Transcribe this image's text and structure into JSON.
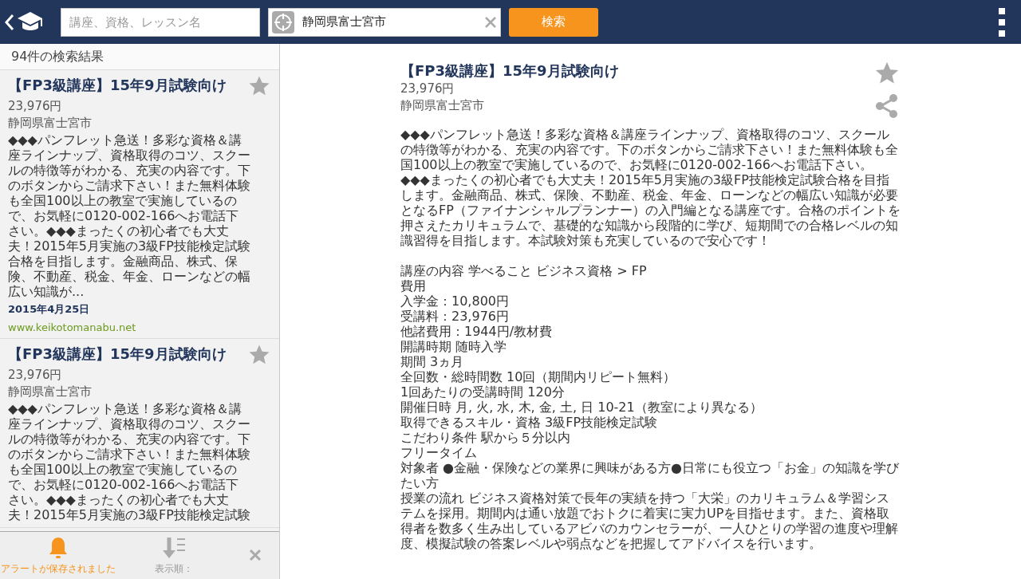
{
  "topbar": {
    "keyword_field": {
      "placeholder": "講座、資格、レッスン名"
    },
    "location_field": {
      "value": "静岡県富士宮市"
    },
    "search_button": "検索"
  },
  "results": {
    "count_label": "94件の検索結果",
    "items": [
      {
        "title": "【FP3級講座】15年9月試験向け",
        "price": "23,976円",
        "location": "静岡県富士宮市",
        "description": "◆◆◆パンフレット急送！多彩な資格＆講座ラインナップ、資格取得のコツ、スクールの特徴等がわかる、充実の内容です。下のボタンからご請求下さい！また無料体験も全国100以上の教室で実施しているので、お気軽に0120-002-166へお電話下さい。◆◆◆まったくの初心者でも大丈夫！2015年5月実施の3級FP技能検定試験合格を目指します。金融商品、株式、保険、不動産、税金、年金、ローンなどの幅広い知識が...",
        "date": "2015年4月25日",
        "site": "www.keikotomanabu.net",
        "starred": false
      },
      {
        "title": "【FP3級講座】15年9月試験向け",
        "price": "23,976円",
        "location": "静岡県富士宮市",
        "description": "◆◆◆パンフレット急送！多彩な資格＆講座ラインナップ、資格取得のコツ、スクールの特徴等がわかる、充実の内容です。下のボタンからご請求下さい！また無料体験も全国100以上の教室で実施しているので、お気軽に0120-002-166へお電話下さい。◆◆◆まったくの初心者でも大丈夫！2015年5月実施の3級FP技能検定試験",
        "starred": false
      }
    ]
  },
  "footer": {
    "alert_label": "アラートが保存されました",
    "sort_label": "表示順："
  },
  "detail": {
    "title": "【FP3級講座】15年9月試験向け",
    "price": "23,976円",
    "location": "静岡県富士宮市",
    "starred": false,
    "description": "◆◆◆パンフレット急送！多彩な資格＆講座ラインナップ、資格取得のコツ、スクールの特徴等がわかる、充実の内容です。下のボタンからご請求下さい！また無料体験も全国100以上の教室で実施しているので、お気軽に0120-002-166へお電話下さい。◆◆◆まったくの初心者でも大丈夫！2015年5月実施の3級FP技能検定試験合格を目指します。金融商品、株式、保険、不動産、税金、年金、ローンなどの幅広い知識が必要となるFP（ファイナンシャルプランナー）の入門編となる講座です。合格のポイントを押さえたカリキュラムで、基礎的な知識から段階的に学び、短期間での合格レベルの知識習得を目指します。本試験対策も充実しているので安心です！",
    "info_lines": [
      "講座の内容 学べること ビジネス資格 > FP",
      "費用",
      "入学金：10,800円",
      "受講料：23,976円",
      "他諸費用：1944円/教材費",
      "開講時期 随時入学",
      "期間 3ヵ月",
      "全回数・総時間数 10回（期間内リピート無料）",
      "1回あたりの受講時間 120分",
      "開催日時 月, 火, 水, 木, 金, 土, 日 10-21（教室により異なる）",
      "取得できるスキル・資格 3級FP技能検定試験",
      "こだわり条件 駅から５分以内",
      "フリータイム",
      "対象者 ●金融・保険などの業界に興味がある方●日常にも役立つ「お金」の知識を学びたい方",
      "授業の流れ ビジネス資格対策で長年の実績を持つ「大栄」のカリキュラム＆学習システムを採用。期間内は通い放題でおトクに着実に実力UPを目指せます。また、資格取得者を数多く生み出しているアビバのカウンセラーが、一人ひとりの学習の進度や理解度、模擬試験の答案レベルや弱点などを把握してアドバイスを行います。"
    ]
  }
}
